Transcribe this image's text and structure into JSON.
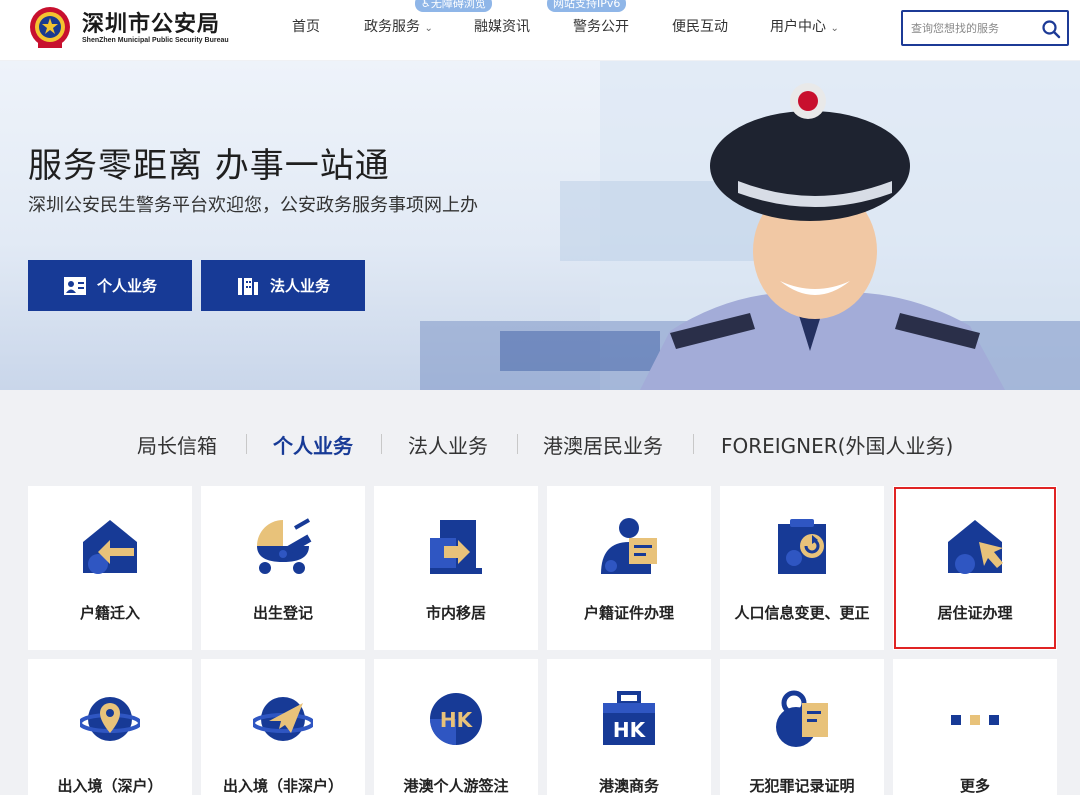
{
  "header": {
    "title": "深圳市公安局",
    "subtitle_en": "ShenZhen Municipal Public Security Bureau",
    "nav": [
      {
        "label": "首页"
      },
      {
        "label": "政务服务"
      },
      {
        "label": "融媒资讯"
      },
      {
        "label": "警务公开"
      },
      {
        "label": "便民互动"
      },
      {
        "label": "用户中心"
      }
    ],
    "badges": {
      "accessibility": "无障碍浏览",
      "ipv6": "网站支持IPv6"
    },
    "search": {
      "placeholder": "查询您想找的服务"
    }
  },
  "hero": {
    "title": "服务零距离 办事一站通",
    "subtitle": "深圳公安民生警务平台欢迎您，公安政务服务事项网上办",
    "buttons": [
      {
        "label": "个人业务"
      },
      {
        "label": "法人业务"
      }
    ]
  },
  "tabs": [
    {
      "label": "局长信箱",
      "active": false
    },
    {
      "label": "个人业务",
      "active": true
    },
    {
      "label": "法人业务",
      "active": false
    },
    {
      "label": "港澳居民业务",
      "active": false
    },
    {
      "label": "FOREIGNER(外国人业务)",
      "active": false
    }
  ],
  "services": [
    {
      "label": "户籍迁入",
      "icon": "house-arrow-icon"
    },
    {
      "label": "出生登记",
      "icon": "stroller-icon"
    },
    {
      "label": "市内移居",
      "icon": "door-arrow-icon"
    },
    {
      "label": "户籍证件办理",
      "icon": "person-card-icon"
    },
    {
      "label": "人口信息变更、更正",
      "icon": "clipboard-refresh-icon"
    },
    {
      "label": "居住证办理",
      "icon": "house-cursor-icon",
      "selected": true
    },
    {
      "label": "出入境（深户）",
      "icon": "planet-pin-icon"
    },
    {
      "label": "出入境（非深户）",
      "icon": "planet-plane-icon"
    },
    {
      "label": "港澳个人游签注",
      "icon": "hk-circle-icon"
    },
    {
      "label": "港澳商务",
      "icon": "hk-briefcase-icon"
    },
    {
      "label": "无犯罪记录证明",
      "icon": "record-document-icon"
    },
    {
      "label": "更多",
      "icon": "more-dots-icon"
    }
  ],
  "colors": {
    "primary": "#173a96",
    "accent": "#e8c27a",
    "selected_border": "#e02424"
  }
}
